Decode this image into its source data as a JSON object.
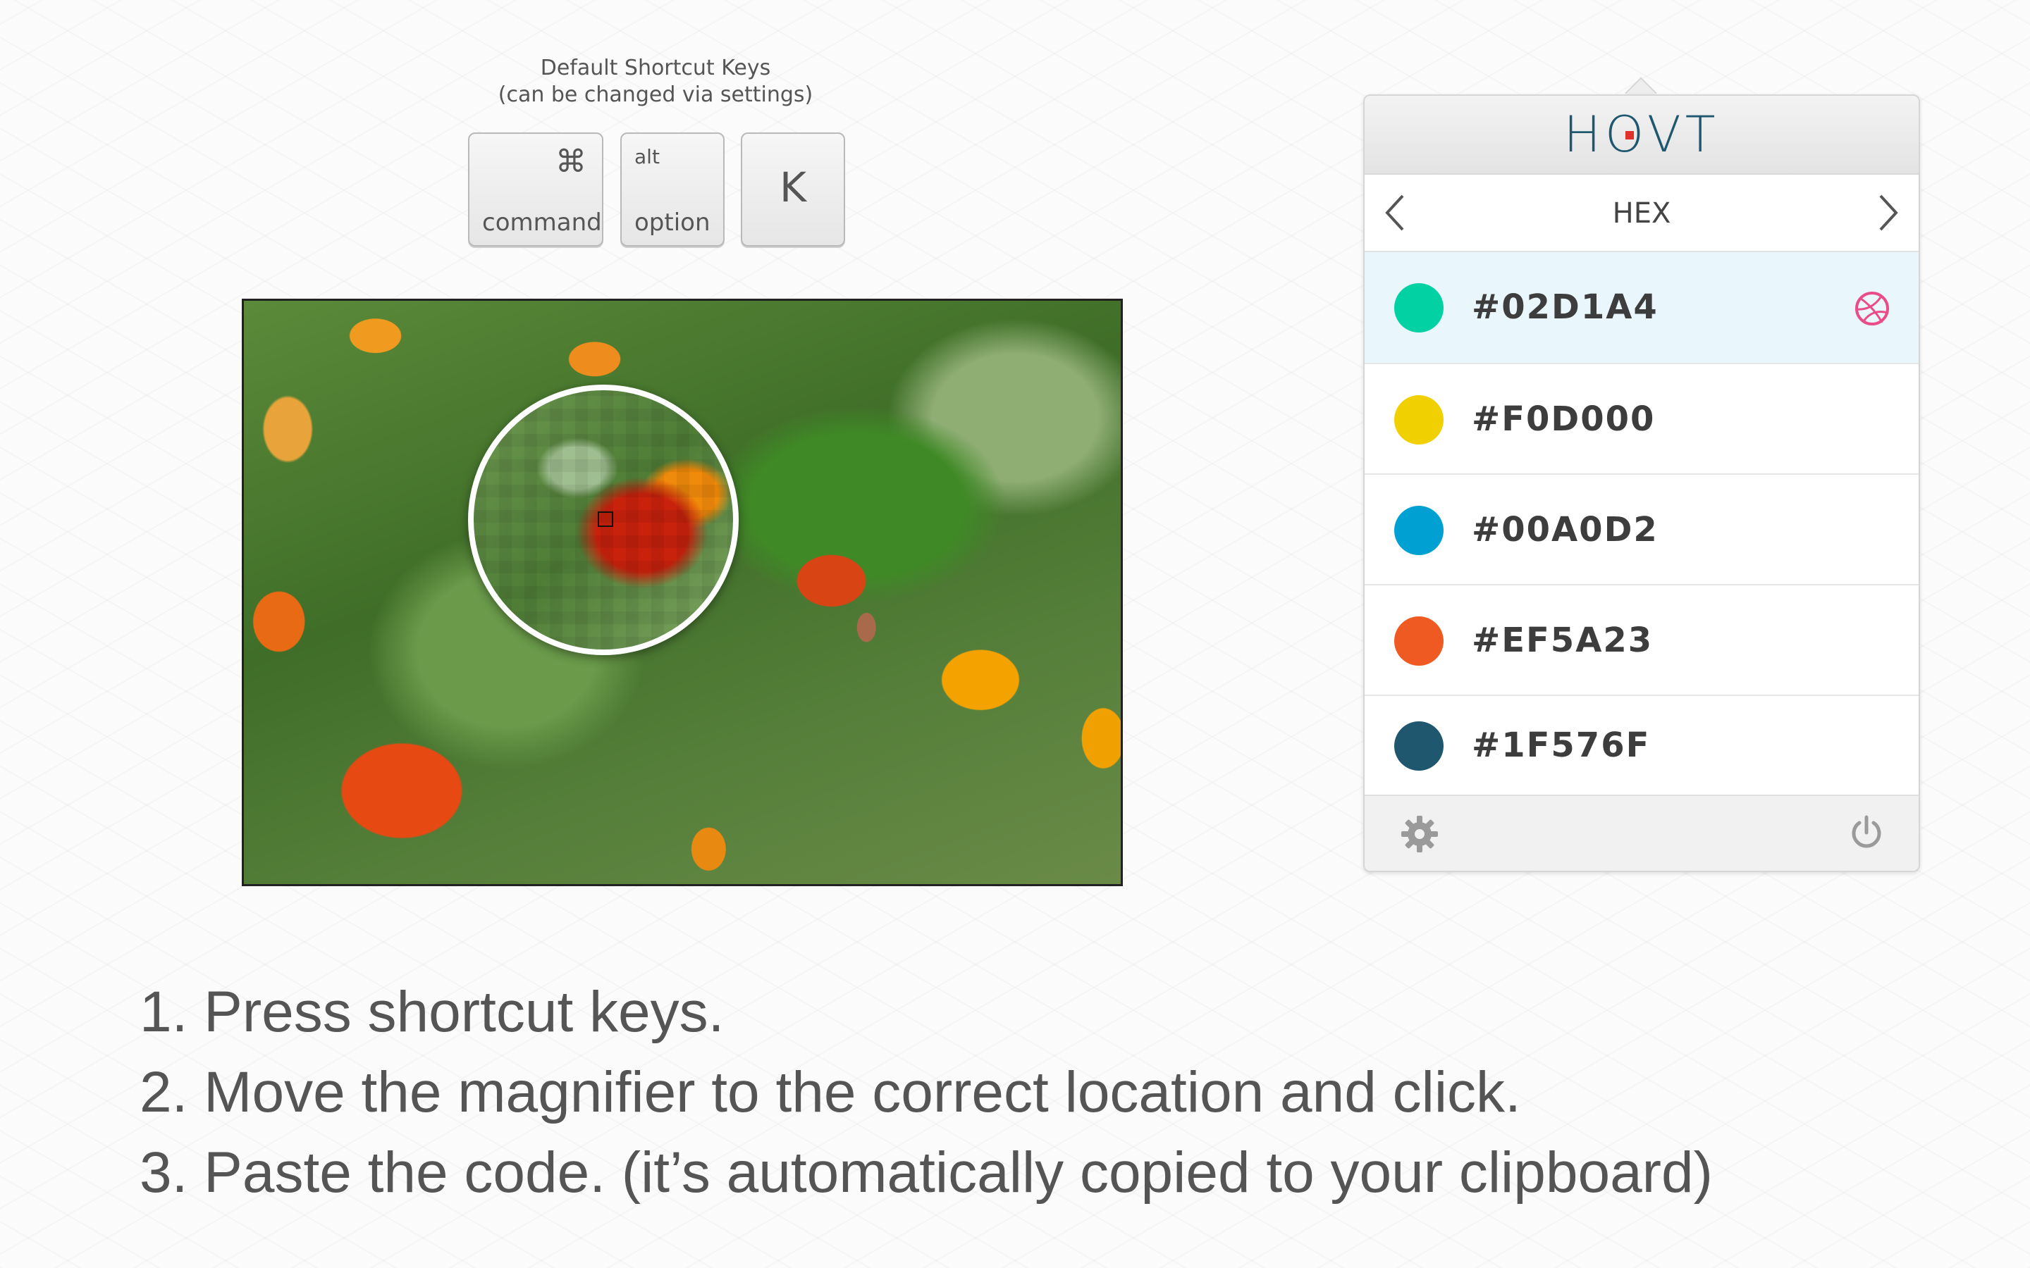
{
  "shortcut": {
    "title": "Default Shortcut Keys",
    "subtitle": "(can be changed via settings)",
    "keys": [
      {
        "symbol": "⌘",
        "label": "command"
      },
      {
        "symbol": "alt",
        "label": "option"
      },
      {
        "symbol": "K"
      }
    ]
  },
  "panel": {
    "logo": "HOVT",
    "format": "HEX",
    "colors": [
      {
        "hex": "#02D1A4",
        "swatch": "#02D1A4",
        "selected": true
      },
      {
        "hex": "#F0D000",
        "swatch": "#F0D000",
        "selected": false
      },
      {
        "hex": "#00A0D2",
        "swatch": "#00A0D2",
        "selected": false
      },
      {
        "hex": "#EF5A23",
        "swatch": "#EF5A23",
        "selected": false
      },
      {
        "hex": "#1F576F",
        "swatch": "#1F576F",
        "selected": false
      }
    ],
    "icons": {
      "prev": "chevron-left-icon",
      "next": "chevron-right-icon",
      "share": "dribbble-icon",
      "settings": "gear-icon",
      "quit": "power-icon"
    },
    "colors_theme": {
      "logo": "#1F576F",
      "logo_dot": "#E2302C",
      "selected_row": "#E9F7FD",
      "dribbble": "#EA4C89"
    }
  },
  "steps": [
    "1. Press shortcut keys.",
    "2. Move the magnifier to the correct location and click.",
    "3. Paste the code. (it’s automatically copied to your clipboard)"
  ]
}
